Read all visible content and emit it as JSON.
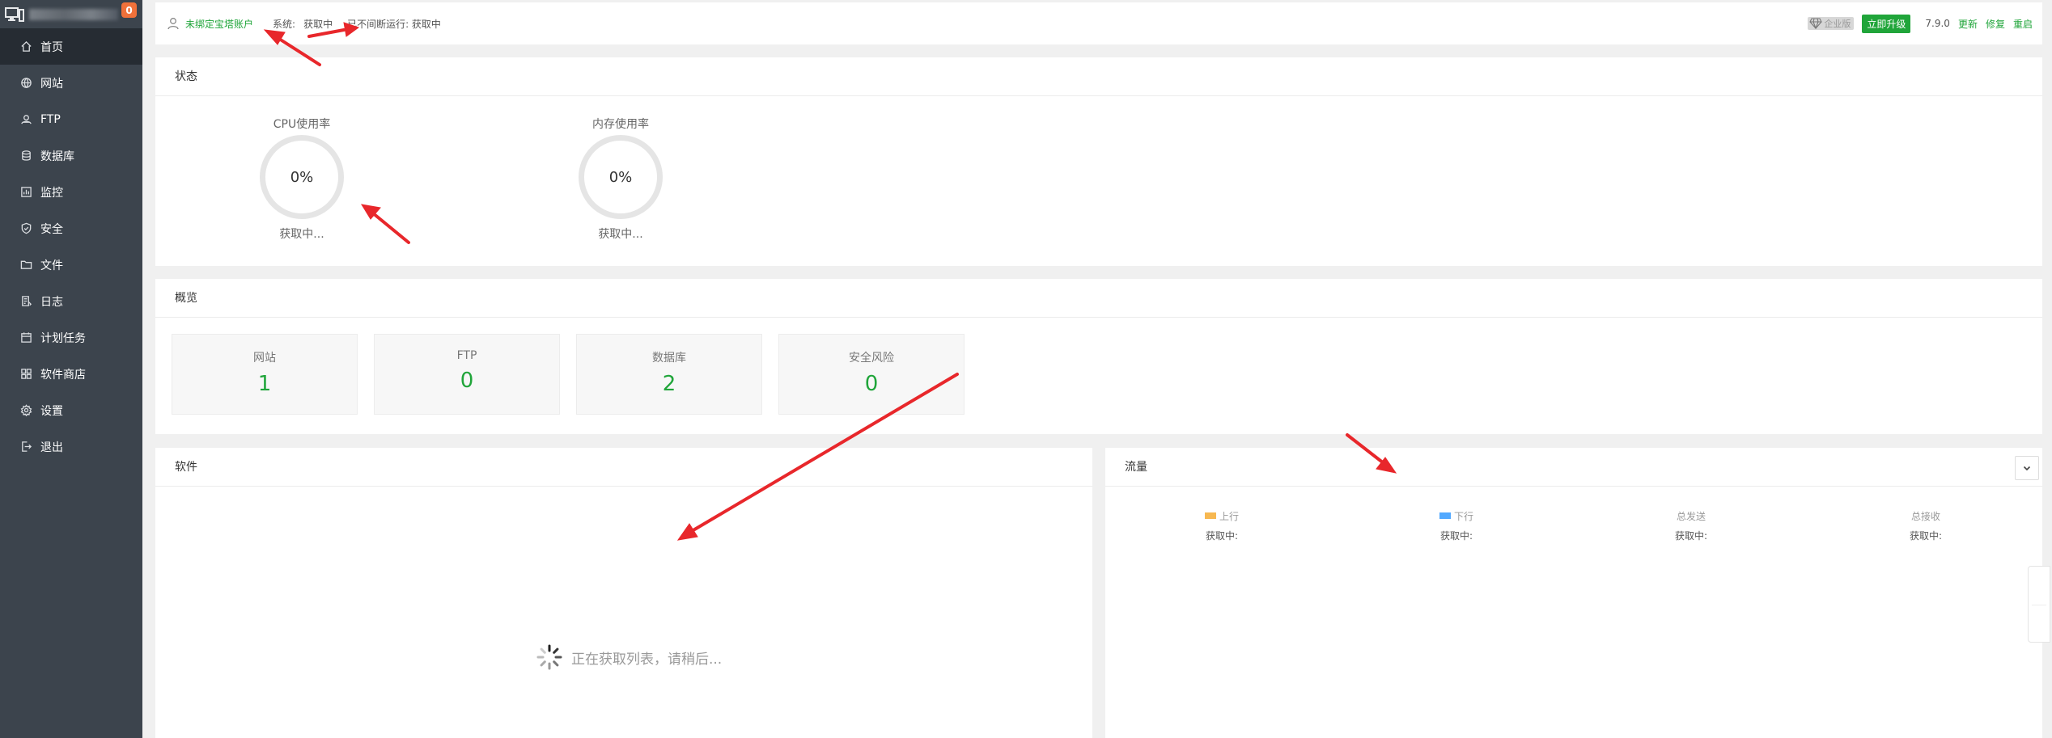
{
  "sidebar": {
    "badge": "0",
    "items": [
      {
        "label": "首页",
        "icon": "home-icon",
        "active": true
      },
      {
        "label": "网站",
        "icon": "globe-icon"
      },
      {
        "label": "FTP",
        "icon": "ftp-icon"
      },
      {
        "label": "数据库",
        "icon": "database-icon"
      },
      {
        "label": "监控",
        "icon": "monitor-chart-icon"
      },
      {
        "label": "安全",
        "icon": "shield-icon"
      },
      {
        "label": "文件",
        "icon": "folder-icon"
      },
      {
        "label": "日志",
        "icon": "log-icon"
      },
      {
        "label": "计划任务",
        "icon": "calendar-icon"
      },
      {
        "label": "软件商店",
        "icon": "apps-grid-icon"
      },
      {
        "label": "设置",
        "icon": "gear-icon"
      },
      {
        "label": "退出",
        "icon": "logout-icon"
      }
    ]
  },
  "topbar": {
    "bind_account": "未绑定宝塔账户",
    "system_label": "系统:",
    "system_value": "获取中",
    "uptime": "已不间断运行: 获取中",
    "enterprise_tag": "企业版",
    "upgrade_button": "立即升级",
    "version": "7.9.0",
    "links": [
      "更新",
      "修复",
      "重启"
    ]
  },
  "status": {
    "title": "状态",
    "gauges": [
      {
        "title": "CPU使用率",
        "value": "0%",
        "sub": "获取中..."
      },
      {
        "title": "内存使用率",
        "value": "0%",
        "sub": "获取中..."
      }
    ]
  },
  "overview": {
    "title": "概览",
    "cards": [
      {
        "label": "网站",
        "value": "1"
      },
      {
        "label": "FTP",
        "value": "0"
      },
      {
        "label": "数据库",
        "value": "2"
      },
      {
        "label": "安全风险",
        "value": "0"
      }
    ]
  },
  "software": {
    "title": "软件",
    "loading_text": "正在获取列表，请稍后..."
  },
  "traffic": {
    "title": "流量",
    "columns": [
      {
        "label": "上行",
        "value": "获取中:",
        "color": "#f7b851"
      },
      {
        "label": "下行",
        "value": "获取中:",
        "color": "#52a9ff"
      },
      {
        "label": "总发送",
        "value": "获取中:"
      },
      {
        "label": "总接收",
        "value": "获取中:"
      }
    ]
  },
  "colors": {
    "accent": "#20a53a",
    "sidebar_bg": "#3c444d",
    "sidebar_active": "#262c33",
    "badge": "#f0713a",
    "annotation_arrow": "#e8272b"
  }
}
